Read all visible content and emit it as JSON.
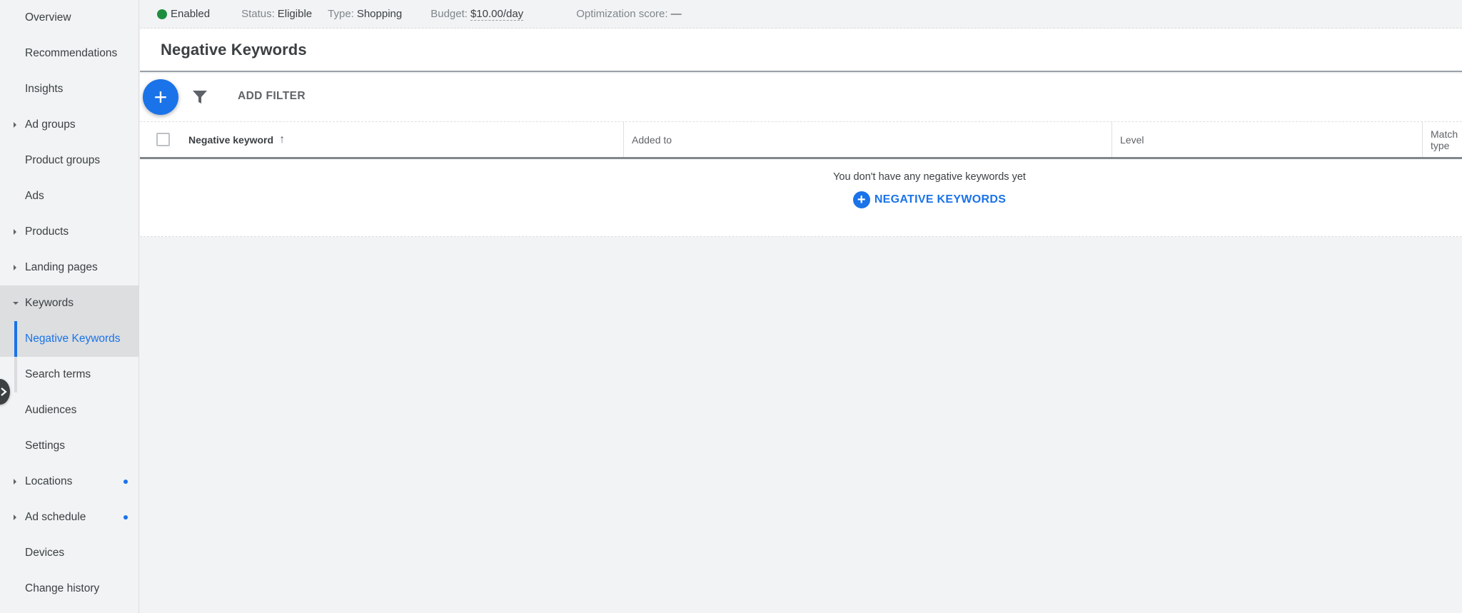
{
  "sidebar": {
    "items": [
      {
        "label": "Overview",
        "expandable": false,
        "dot": false
      },
      {
        "label": "Recommendations",
        "expandable": false,
        "dot": false
      },
      {
        "label": "Insights",
        "expandable": false,
        "dot": false
      },
      {
        "label": "Ad groups",
        "expandable": true,
        "dot": false
      },
      {
        "label": "Product groups",
        "expandable": false,
        "dot": false
      },
      {
        "label": "Ads",
        "expandable": false,
        "dot": false
      },
      {
        "label": "Products",
        "expandable": true,
        "dot": false
      },
      {
        "label": "Landing pages",
        "expandable": true,
        "dot": false
      },
      {
        "label": "Keywords",
        "expandable": true,
        "expanded": true,
        "dot": false
      },
      {
        "label": "Negative Keywords",
        "sub": true,
        "selected": true
      },
      {
        "label": "Search terms",
        "sub": true
      },
      {
        "label": "Audiences",
        "expandable": false,
        "dot": false
      },
      {
        "label": "Settings",
        "expandable": false,
        "dot": false
      },
      {
        "label": "Locations",
        "expandable": true,
        "dot": true
      },
      {
        "label": "Ad schedule",
        "expandable": true,
        "dot": true
      },
      {
        "label": "Devices",
        "expandable": false,
        "dot": false
      },
      {
        "label": "Change history",
        "expandable": false,
        "dot": false
      }
    ],
    "collapse_icon": "chevron-right-icon"
  },
  "statusbar": {
    "campaign_state": "Enabled",
    "status_label": "Status:",
    "status_value": "Eligible",
    "type_label": "Type:",
    "type_value": "Shopping",
    "budget_label": "Budget:",
    "budget_value": "$10.00/day",
    "optimization_label": "Optimization score:",
    "optimization_value": "—"
  },
  "page": {
    "title": "Negative Keywords"
  },
  "toolbar": {
    "add_icon": "+",
    "filter_icon": "filter-icon",
    "add_filter_label": "ADD FILTER"
  },
  "table": {
    "columns": [
      {
        "label": "Negative keyword",
        "sort": "ascending"
      },
      {
        "label": "Added to"
      },
      {
        "label": "Level"
      },
      {
        "label": "Match type"
      }
    ],
    "sort_icon": "↑",
    "rows": [],
    "empty_message": "You don't have any negative keywords yet",
    "empty_action_label": "NEGATIVE KEYWORDS",
    "empty_action_icon": "+"
  },
  "colors": {
    "accent": "#1a73e8",
    "enabled": "#1e8e3e",
    "background": "#f1f3f4"
  }
}
